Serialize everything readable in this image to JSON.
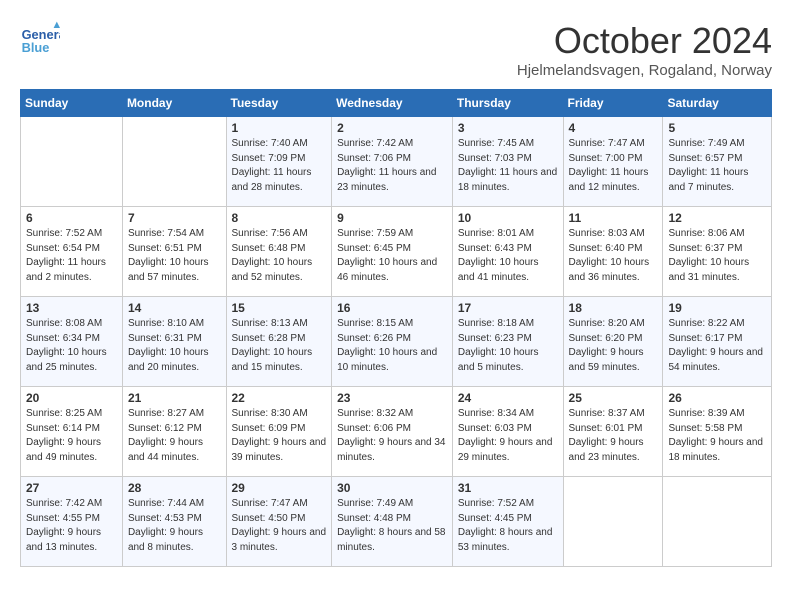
{
  "header": {
    "logo_line1": "General",
    "logo_line2": "Blue",
    "month": "October 2024",
    "location": "Hjelmelandsvagen, Rogaland, Norway"
  },
  "weekdays": [
    "Sunday",
    "Monday",
    "Tuesday",
    "Wednesday",
    "Thursday",
    "Friday",
    "Saturday"
  ],
  "weeks": [
    [
      {
        "day": "",
        "detail": ""
      },
      {
        "day": "",
        "detail": ""
      },
      {
        "day": "1",
        "detail": "Sunrise: 7:40 AM\nSunset: 7:09 PM\nDaylight: 11 hours and 28 minutes."
      },
      {
        "day": "2",
        "detail": "Sunrise: 7:42 AM\nSunset: 7:06 PM\nDaylight: 11 hours and 23 minutes."
      },
      {
        "day": "3",
        "detail": "Sunrise: 7:45 AM\nSunset: 7:03 PM\nDaylight: 11 hours and 18 minutes."
      },
      {
        "day": "4",
        "detail": "Sunrise: 7:47 AM\nSunset: 7:00 PM\nDaylight: 11 hours and 12 minutes."
      },
      {
        "day": "5",
        "detail": "Sunrise: 7:49 AM\nSunset: 6:57 PM\nDaylight: 11 hours and 7 minutes."
      }
    ],
    [
      {
        "day": "6",
        "detail": "Sunrise: 7:52 AM\nSunset: 6:54 PM\nDaylight: 11 hours and 2 minutes."
      },
      {
        "day": "7",
        "detail": "Sunrise: 7:54 AM\nSunset: 6:51 PM\nDaylight: 10 hours and 57 minutes."
      },
      {
        "day": "8",
        "detail": "Sunrise: 7:56 AM\nSunset: 6:48 PM\nDaylight: 10 hours and 52 minutes."
      },
      {
        "day": "9",
        "detail": "Sunrise: 7:59 AM\nSunset: 6:45 PM\nDaylight: 10 hours and 46 minutes."
      },
      {
        "day": "10",
        "detail": "Sunrise: 8:01 AM\nSunset: 6:43 PM\nDaylight: 10 hours and 41 minutes."
      },
      {
        "day": "11",
        "detail": "Sunrise: 8:03 AM\nSunset: 6:40 PM\nDaylight: 10 hours and 36 minutes."
      },
      {
        "day": "12",
        "detail": "Sunrise: 8:06 AM\nSunset: 6:37 PM\nDaylight: 10 hours and 31 minutes."
      }
    ],
    [
      {
        "day": "13",
        "detail": "Sunrise: 8:08 AM\nSunset: 6:34 PM\nDaylight: 10 hours and 25 minutes."
      },
      {
        "day": "14",
        "detail": "Sunrise: 8:10 AM\nSunset: 6:31 PM\nDaylight: 10 hours and 20 minutes."
      },
      {
        "day": "15",
        "detail": "Sunrise: 8:13 AM\nSunset: 6:28 PM\nDaylight: 10 hours and 15 minutes."
      },
      {
        "day": "16",
        "detail": "Sunrise: 8:15 AM\nSunset: 6:26 PM\nDaylight: 10 hours and 10 minutes."
      },
      {
        "day": "17",
        "detail": "Sunrise: 8:18 AM\nSunset: 6:23 PM\nDaylight: 10 hours and 5 minutes."
      },
      {
        "day": "18",
        "detail": "Sunrise: 8:20 AM\nSunset: 6:20 PM\nDaylight: 9 hours and 59 minutes."
      },
      {
        "day": "19",
        "detail": "Sunrise: 8:22 AM\nSunset: 6:17 PM\nDaylight: 9 hours and 54 minutes."
      }
    ],
    [
      {
        "day": "20",
        "detail": "Sunrise: 8:25 AM\nSunset: 6:14 PM\nDaylight: 9 hours and 49 minutes."
      },
      {
        "day": "21",
        "detail": "Sunrise: 8:27 AM\nSunset: 6:12 PM\nDaylight: 9 hours and 44 minutes."
      },
      {
        "day": "22",
        "detail": "Sunrise: 8:30 AM\nSunset: 6:09 PM\nDaylight: 9 hours and 39 minutes."
      },
      {
        "day": "23",
        "detail": "Sunrise: 8:32 AM\nSunset: 6:06 PM\nDaylight: 9 hours and 34 minutes."
      },
      {
        "day": "24",
        "detail": "Sunrise: 8:34 AM\nSunset: 6:03 PM\nDaylight: 9 hours and 29 minutes."
      },
      {
        "day": "25",
        "detail": "Sunrise: 8:37 AM\nSunset: 6:01 PM\nDaylight: 9 hours and 23 minutes."
      },
      {
        "day": "26",
        "detail": "Sunrise: 8:39 AM\nSunset: 5:58 PM\nDaylight: 9 hours and 18 minutes."
      }
    ],
    [
      {
        "day": "27",
        "detail": "Sunrise: 7:42 AM\nSunset: 4:55 PM\nDaylight: 9 hours and 13 minutes."
      },
      {
        "day": "28",
        "detail": "Sunrise: 7:44 AM\nSunset: 4:53 PM\nDaylight: 9 hours and 8 minutes."
      },
      {
        "day": "29",
        "detail": "Sunrise: 7:47 AM\nSunset: 4:50 PM\nDaylight: 9 hours and 3 minutes."
      },
      {
        "day": "30",
        "detail": "Sunrise: 7:49 AM\nSunset: 4:48 PM\nDaylight: 8 hours and 58 minutes."
      },
      {
        "day": "31",
        "detail": "Sunrise: 7:52 AM\nSunset: 4:45 PM\nDaylight: 8 hours and 53 minutes."
      },
      {
        "day": "",
        "detail": ""
      },
      {
        "day": "",
        "detail": ""
      }
    ]
  ]
}
